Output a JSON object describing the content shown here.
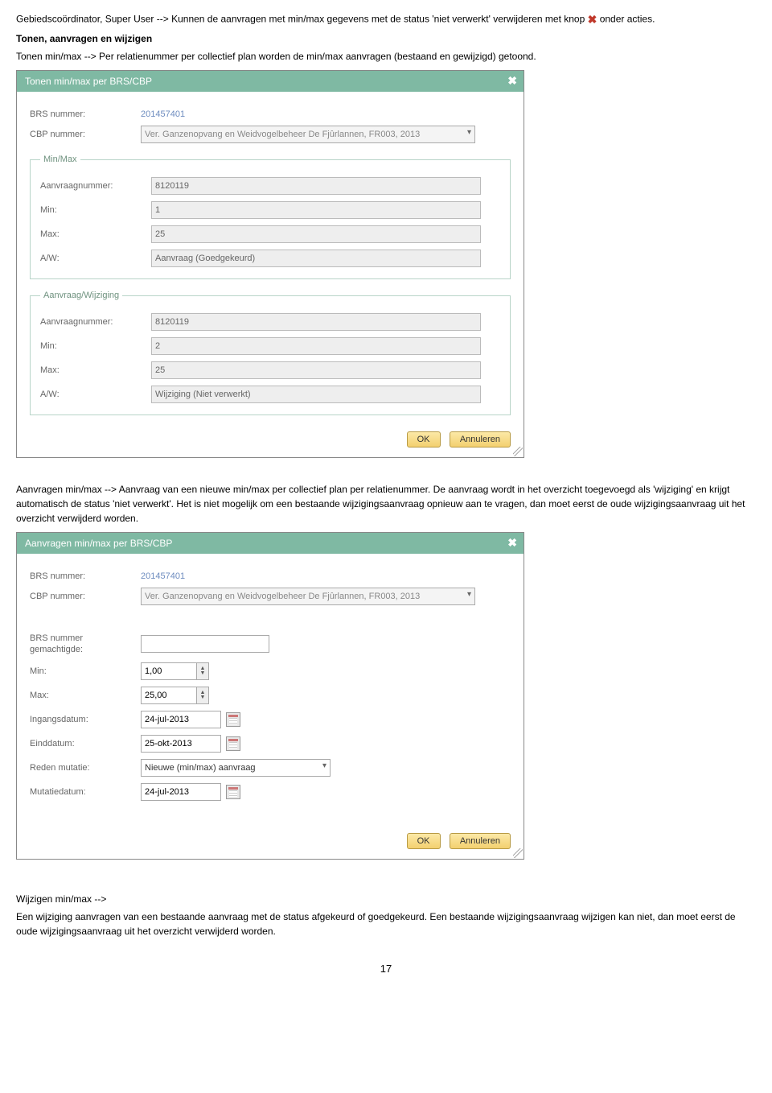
{
  "text": {
    "p1a": "Gebiedscoördinator, Super User --> Kunnen de aanvragen met min/max gegevens met de status 'niet verwerkt' verwijderen met knop ",
    "p1b": " onder acties.",
    "h1": "Tonen, aanvragen en wijzigen",
    "p2": "Tonen min/max --> Per relatienummer per collectief plan worden de min/max aanvragen (bestaand en gewijzigd) getoond.",
    "p3": "Aanvragen min/max --> Aanvraag van een nieuwe min/max per collectief plan per relatienummer. De aanvraag wordt in het overzicht toegevoegd als 'wijziging' en krijgt automatisch de status 'niet verwerkt'. Het is niet mogelijk om een bestaande wijzigingsaanvraag opnieuw aan te vragen, dan moet eerst de oude wijzigingsaanvraag uit het overzicht verwijderd worden.",
    "p4a": "Wijzigen min/max -->",
    "p4b": "Een wijziging aanvragen van een bestaande aanvraag met de status afgekeurd of goedgekeurd. Een bestaande wijzigingsaanvraag wijzigen kan niet, dan moet eerst de oude wijzigingsaanvraag uit het overzicht verwijderd worden.",
    "page": "17"
  },
  "dialog1": {
    "title": "Tonen min/max per BRS/CBP",
    "brs_label": "BRS nummer:",
    "brs_value": "201457401",
    "cbp_label": "CBP nummer:",
    "cbp_value": "Ver. Ganzenopvang en Weidvogelbeheer De Fjûrlannen, FR003, 2013",
    "group_minmax": "Min/Max",
    "group_aw": "Aanvraag/Wijziging",
    "aanvraagnummer_label": "Aanvraagnummer:",
    "min_label": "Min:",
    "max_label": "Max:",
    "aw_label": "A/W:",
    "minmax": {
      "aanvraagnummer": "8120119",
      "min": "1",
      "max": "25",
      "aw": "Aanvraag (Goedgekeurd)"
    },
    "aw": {
      "aanvraagnummer": "8120119",
      "min": "2",
      "max": "25",
      "aw": "Wijziging (Niet verwerkt)"
    },
    "ok": "OK",
    "cancel": "Annuleren"
  },
  "dialog2": {
    "title": "Aanvragen min/max per BRS/CBP",
    "brs_label": "BRS nummer:",
    "brs_value": "201457401",
    "cbp_label": "CBP nummer:",
    "cbp_value": "Ver. Ganzenopvang en Weidvogelbeheer De Fjûrlannen, FR003, 2013",
    "gemachtigde_label": "BRS nummer gemachtigde:",
    "gemachtigde_value": "",
    "min_label": "Min:",
    "min_value": "1,00",
    "max_label": "Max:",
    "max_value": "25,00",
    "ingang_label": "Ingangsdatum:",
    "ingang_value": "24-jul-2013",
    "eind_label": "Einddatum:",
    "eind_value": "25-okt-2013",
    "reden_label": "Reden mutatie:",
    "reden_value": "Nieuwe (min/max) aanvraag",
    "mut_label": "Mutatiedatum:",
    "mut_value": "24-jul-2013",
    "ok": "OK",
    "cancel": "Annuleren"
  }
}
